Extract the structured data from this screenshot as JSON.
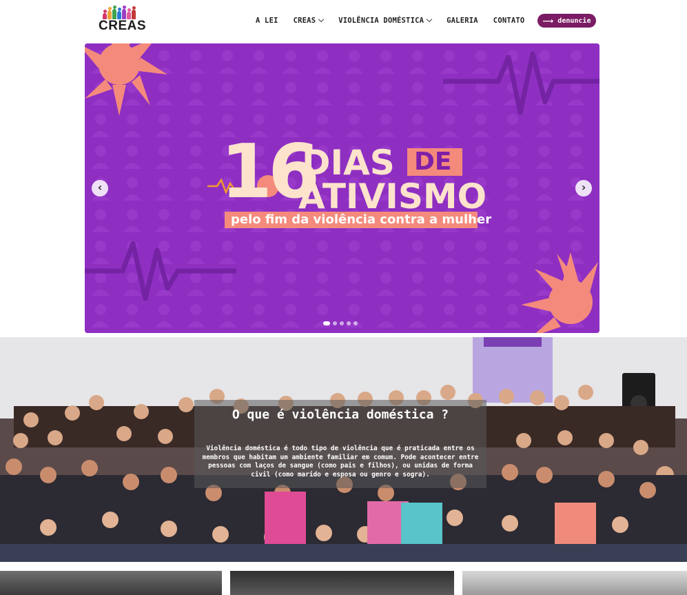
{
  "brand": {
    "logo_text": "CREAS"
  },
  "nav": {
    "items": [
      {
        "label": "A LEI",
        "dropdown": false
      },
      {
        "label": "CREAS",
        "dropdown": true
      },
      {
        "label": "VIOLÊNCIA DOMÉSTICA",
        "dropdown": true
      },
      {
        "label": "GALERIA",
        "dropdown": false
      },
      {
        "label": "CONTATO",
        "dropdown": false
      }
    ],
    "cta_label": "denuncie",
    "cta_icon": "arrow-right-icon"
  },
  "carousel": {
    "slide": {
      "number": "16",
      "line1": "DIAS",
      "line1_badge": "DE",
      "line2": "ATIVISMO",
      "subtitle": "pelo fim da violência contra a mulher"
    },
    "prev_label": "‹",
    "next_label": "›",
    "slide_count": 5,
    "active_index": 0
  },
  "info": {
    "title": "O que é violência doméstica ?",
    "text": "Violência doméstica é todo tipo de violência que é praticada entre os membros que habitam um ambiente familiar em comum. Pode acontecer entre pessoas com laços de sangue (como pais e filhos), ou unidas de forma civil (como marido e esposa ou genro e sogra)."
  },
  "colors": {
    "brand": "#7a1c63",
    "slide_bg": "#8e2fc2",
    "slide_accent": "#f48a7c",
    "slide_text": "#fde3cc"
  }
}
